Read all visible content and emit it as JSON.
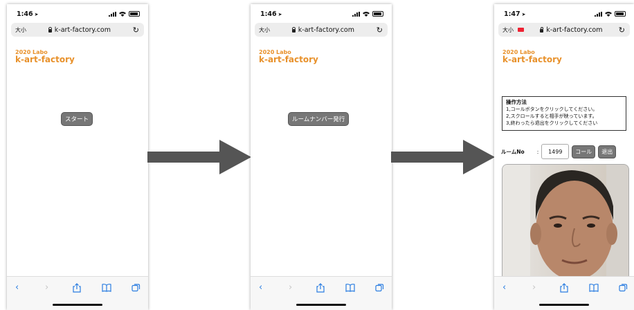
{
  "screens": [
    {
      "time": "1:46",
      "aa_label": "大小",
      "url": "k-art-factory.com",
      "logo_line1": "2020 Labo",
      "logo_line2": "k-art-factory",
      "center_button": "スタート"
    },
    {
      "time": "1:46",
      "aa_label": "大小",
      "url": "k-art-factory.com",
      "logo_line1": "2020 Labo",
      "logo_line2": "k-art-factory",
      "center_button": "ルームナンバー発行"
    },
    {
      "time": "1:47",
      "aa_label": "大小",
      "url": "k-art-factory.com",
      "logo_line1": "2020 Labo",
      "logo_line2": "k-art-factory",
      "instructions_title": "操作方法",
      "instructions": [
        "1,コールボタンをクリックしてください。",
        "2,スクロールすると相手が映っています。",
        "3,終わったら退出をクリックしてください"
      ],
      "room_label": "ルームNo",
      "room_colon": ":",
      "room_value": "1499",
      "call_button": "コール",
      "exit_button": "退出"
    }
  ],
  "toolbar_icons": [
    "back-icon",
    "forward-icon",
    "share-icon",
    "bookmarks-icon",
    "tabs-icon"
  ],
  "colors": {
    "logo": "#e8912b",
    "link": "#2a7de1",
    "button": "#777777",
    "arrow": "#555555"
  }
}
